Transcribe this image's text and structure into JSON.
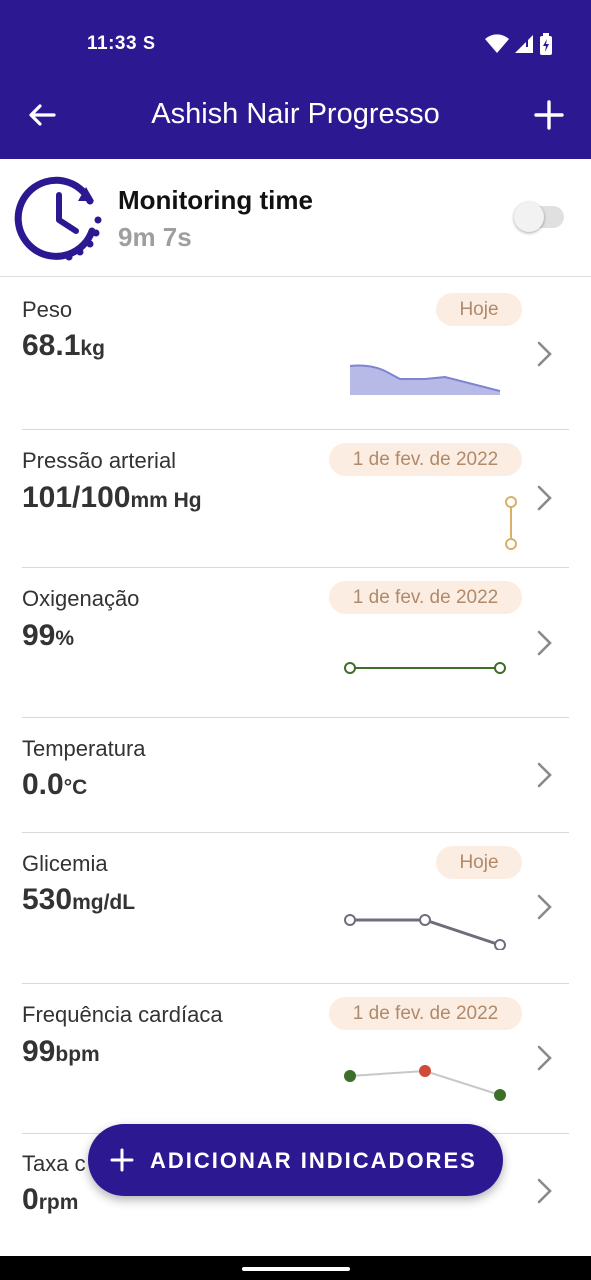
{
  "status_bar": {
    "time": "11:33",
    "s_icon": "S"
  },
  "header": {
    "title": "Ashish Nair Progresso",
    "back_icon": "arrow-left-icon",
    "add_icon": "plus-icon"
  },
  "monitoring": {
    "title": "Monitoring time",
    "elapsed": "9m 7s",
    "toggle_on": false
  },
  "indicators": [
    {
      "label": "Peso",
      "value": "68.1",
      "unit": "kg",
      "badge": "Hoje"
    },
    {
      "label": "Pressão arterial",
      "value": "101/100",
      "unit": "mm Hg",
      "badge": "1 de fev. de 2022"
    },
    {
      "label": "Oxigenação",
      "value": "99",
      "unit": "%",
      "badge": "1 de fev. de 2022"
    },
    {
      "label": "Temperatura",
      "value": "0.0",
      "unit": "°C",
      "badge": ""
    },
    {
      "label": "Glicemia",
      "value": "530",
      "unit": "mg/dL",
      "badge": "Hoje"
    },
    {
      "label": "Frequência cardíaca",
      "value": "99",
      "unit": "bpm",
      "badge": "1 de fev. de 2022"
    },
    {
      "label": "Taxa c",
      "value": "0",
      "unit": "rpm",
      "badge": ""
    }
  ],
  "fab": {
    "label": "ADICIONAR INDICADORES"
  },
  "colors": {
    "primary": "#2c1890",
    "badge_bg": "#fbede2",
    "badge_text": "#b08a6a"
  }
}
